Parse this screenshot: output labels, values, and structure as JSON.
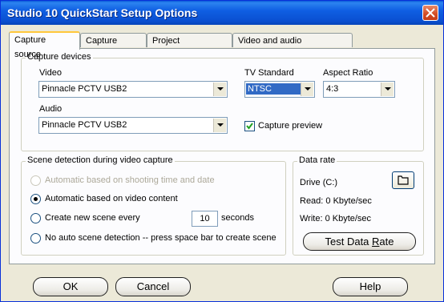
{
  "window": {
    "title": "Studio 10 QuickStart Setup Options"
  },
  "tabs": [
    {
      "label": "Capture source",
      "active": true
    },
    {
      "label": "Capture format"
    },
    {
      "label": "Project preferences"
    },
    {
      "label": "Video and audio preferences"
    }
  ],
  "capture_devices": {
    "group_label": "Capture devices",
    "video_label": "Video",
    "video_value": "Pinnacle PCTV USB2",
    "audio_label": "Audio",
    "audio_value": "Pinnacle PCTV USB2",
    "tv_standard_label": "TV Standard",
    "tv_standard_value": "NTSC",
    "aspect_ratio_label": "Aspect Ratio",
    "aspect_ratio_value": "4:3",
    "capture_preview_label": "Capture preview",
    "capture_preview_checked": true
  },
  "scene_detection": {
    "group_label": "Scene detection during video capture",
    "options": [
      {
        "label": "Automatic based on shooting time and date",
        "enabled": false,
        "selected": false
      },
      {
        "label": "Automatic based on video content",
        "enabled": true,
        "selected": true
      },
      {
        "label": "Create new scene every",
        "enabled": true,
        "selected": false
      },
      {
        "label": "No auto scene detection -- press space bar to create scene",
        "enabled": true,
        "selected": false
      }
    ],
    "interval_value": "10",
    "interval_unit": "seconds"
  },
  "data_rate": {
    "group_label": "Data rate",
    "drive_label": "Drive (C:)",
    "read_label": "Read: 0 Kbyte/sec",
    "write_label": "Write: 0 Kbyte/sec",
    "test_button_prefix": "Test Data ",
    "test_button_accel": "R",
    "test_button_suffix": "ate"
  },
  "footer": {
    "ok_label": "OK",
    "cancel_label": "Cancel",
    "help_label": "Help"
  }
}
